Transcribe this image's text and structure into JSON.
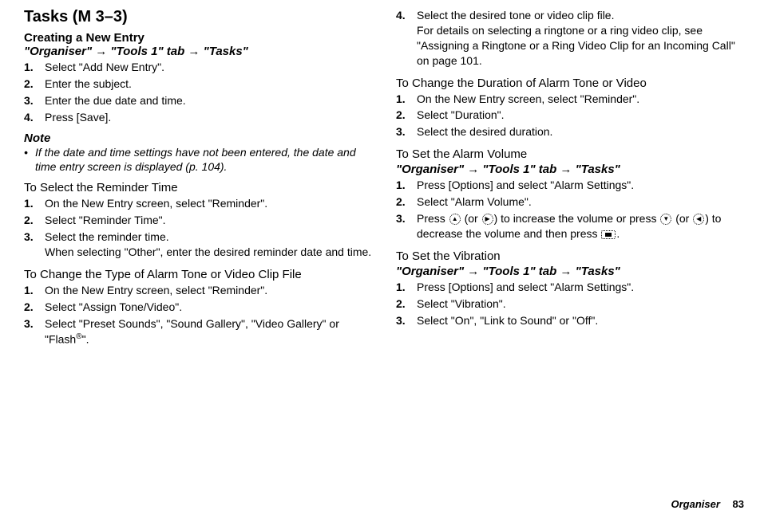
{
  "title": "Tasks (M 3–3)",
  "left": {
    "subheading": "Creating a New Entry",
    "path": "\"Organiser\" → \"Tools 1\" tab → \"Tasks\"",
    "steps1": [
      "Select \"Add New Entry\".",
      "Enter the subject.",
      "Enter the due date and time.",
      "Press [Save]."
    ],
    "note_label": "Note",
    "note_text": "If the date and time settings have not been entered, the date and time entry screen is displayed (p. 104).",
    "section2": "To Select the Reminder Time",
    "steps2": [
      "On the New Entry screen, select \"Reminder\".",
      "Select \"Reminder Time\".",
      "Select the reminder time."
    ],
    "step2_sub": "When selecting \"Other\", enter the desired reminder date and time.",
    "section3": "To Change the Type of Alarm Tone or Video Clip File",
    "steps3": [
      "On the New Entry screen, select \"Reminder\".",
      "Select \"Assign Tone/Video\".",
      "Select \"Preset Sounds\", \"Sound Gallery\", \"Video Gallery\" or \"Flash®\"."
    ]
  },
  "right": {
    "step4_num": "4.",
    "step4_text": "Select the desired tone or video clip file.",
    "step4_sub": "For details on selecting a ringtone or a ring video clip, see \"Assigning a Ringtone or a Ring Video Clip for an Incoming Call\" on page 101.",
    "section1": "To Change the Duration of Alarm Tone or Video",
    "steps1": [
      "On the New Entry screen, select \"Reminder\".",
      "Select \"Duration\".",
      "Select the desired duration."
    ],
    "section2": "To Set the Alarm Volume",
    "path2": "\"Organiser\" → \"Tools 1\" tab → \"Tasks\"",
    "steps2": [
      "Press [Options] and select \"Alarm Settings\".",
      "Select \"Alarm Volume\"."
    ],
    "step2_3_pre": "Press ",
    "step2_3_mid1": " (or ",
    "step2_3_mid2": ") to increase the volume or press ",
    "step2_3_mid3": " (or ",
    "step2_3_mid4": ") to decrease the volume and then press ",
    "step2_3_end": ".",
    "section3": "To Set the Vibration",
    "path3": "\"Organiser\" → \"Tools 1\" tab → \"Tasks\"",
    "steps3": [
      "Press [Options] and select \"Alarm Settings\".",
      "Select \"Vibration\".",
      "Select \"On\", \"Link to Sound\" or \"Off\"."
    ]
  },
  "footer": {
    "section": "Organiser",
    "page": "83"
  }
}
